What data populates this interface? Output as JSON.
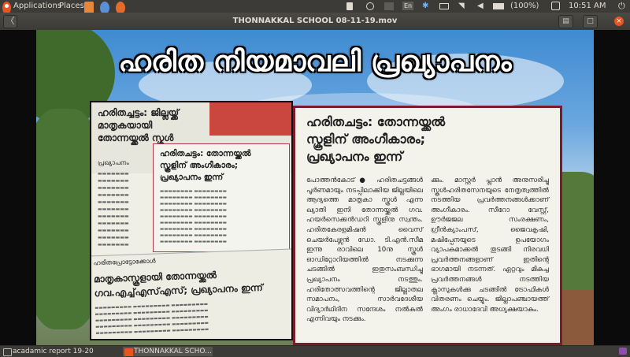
{
  "top_panel": {
    "applications_label": "Applications",
    "places_label": "Places",
    "indicators": {
      "lang": "En",
      "battery": "(100%)",
      "clock": "10:51 AM"
    }
  },
  "window": {
    "title": "THONNAKKAL SCHOOL 08-11-19.mov",
    "back_glyph": "〈"
  },
  "video": {
    "main_title": "ഹരിത നിയമാവലി പ്രഖ്യാപനം",
    "clip_left": {
      "headline1_line1": "ഹരിതച്ചട്ടം: ജില്ലയ്ക്ക്",
      "headline1_line2": "മാതൃകയായി",
      "headline1_line3": "തോന്നയ്ക്കൽ സ്കൂൾ",
      "small_heading": "പ്രഖ്യാപനം",
      "inset_line1": "ഹരിതചട്ടം: തോന്നയ്ക്കൽ",
      "inset_line2": "സ്കൂളിന് അംഗീകാരം;",
      "inset_line3": "പ്രഖ്യാപനം ഇന്ന്",
      "section_tag": "ഹരിതപ്രോട്ടോക്കോൾ",
      "bottom_line1": "മാതൃകാസ്കൂളായി തോന്നയ്ക്കൽ",
      "bottom_line2": "ഗവ.എച്ച്എസ്എസ്; പ്രഖ്യാപനം ഇന്ന്"
    },
    "clip_right": {
      "headline_line1": "ഹരിതചട്ടം: തോന്നയ്ക്കൽ",
      "headline_line2": "സ്കൂളിന് അംഗീകാരം;",
      "headline_line3": "പ്രഖ്യാപനം ഇന്ന്",
      "col1": "പോത്തൻകോട്● ഹരിതചട്ടങ്ങൾ പൂർണമായും നടപ്പിലാക്കിയ ജില്ലയിലെ ആദ്യത്തെ മാതൃകാ സ്കൂൾ എന്ന ഖ്യാതി ഇനി തോന്നയ്ക്കൽ ഗവ. ഹയർസെക്കൻഡറി സ്കൂളിനു സ്വന്തം. ഹരിതകേരളമിഷൻ വൈസ് ചെയർപേഴ്സൻ ഡോ. ടി.എൻ.സീമ ഇന്നു രാവിലെ 10നു സ്കൂൾ ഓഡിറ്റോറിയത്തിൽ നടക്കുന്ന ചടങ്ങിൽ ഇതുസംബന്ധിച്ചു പ്രഖ്യാപനം നടത്തും. ഹരിതോത്സവത്തിന്റെ ജില്ലാതല സമാപനം, സാർവദേശീയ വിദ്യാർഥിദിന സന്ദേശം നൽകൽ എന്നിവയും നടക്കും.",
      "col2": "ക്കും. മാസ്റ്റർ പ്ലാൻ അനുസരിച്ചു സ്കൂൾഹരിതസേനയുടെ നേതൃത്വത്തിൽ നടത്തിയ പ്രവർത്തനങ്ങൾക്കാണ് അംഗീകാരം. സീറോ വേസ്റ്റ്, ഊർജജല സംരക്ഷണം, ഗ്രീൻക്യാംപസ്, ജൈവകൃഷി, മഷിപ്പേനയുടെ ഉപയോഗം വ്യാപകമാക്കൽ തുടങ്ങി നിരവധി പ്രവർത്തനങ്ങളാണ് ഇതിന്റെ ഭാഗമായി നടന്നത്. ഏറ്റവും മികച്ച പ്രവർത്തനങ്ങൾ നടത്തിയ ക്ലാസുകൾക്കു ചടങ്ങിൽ ട്രോഫികൾ വിതരണം ചെയ്യും. ജില്ലാപഞ്ചായത്ത് അംഗം രാധാദേവി അധ്യക്ഷയാകും."
    }
  },
  "taskbar": {
    "task1": "acadamic report 19-20",
    "task2": "THONNAKKAL SCHO..."
  },
  "colors": {
    "panel": "#3c3b37",
    "ubuntu_orange": "#e95420",
    "clip_border": "#7a1c2a"
  }
}
